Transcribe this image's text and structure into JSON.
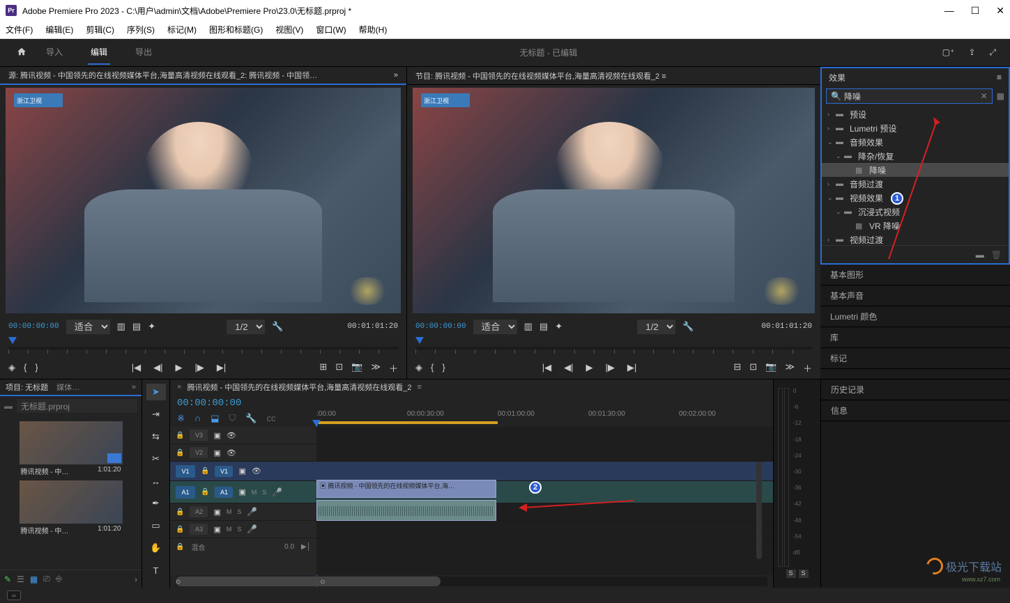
{
  "window": {
    "app_badge": "Pr",
    "title": "Adobe Premiere Pro 2023 - C:\\用户\\admin\\文档\\Adobe\\Premiere Pro\\23.0\\无标题.prproj *"
  },
  "menu": [
    "文件(F)",
    "编辑(E)",
    "剪辑(C)",
    "序列(S)",
    "标记(M)",
    "图形和标题(G)",
    "视图(V)",
    "窗口(W)",
    "帮助(H)"
  ],
  "workspace": {
    "tabs": [
      "导入",
      "编辑",
      "导出"
    ],
    "active": 1,
    "center": "无标题 - 已编辑"
  },
  "source_monitor": {
    "title": "源: 腾讯视频 - 中国领先的在线视频媒体平台,海量高清视频在线观看_2: 腾讯视频 - 中国领…",
    "channel": "浙江卫视",
    "timecode_left": "00:00:00:00",
    "fit": "适合",
    "zoom": "1/2",
    "timecode_right": "00:01:01:20"
  },
  "program_monitor": {
    "title": "节目: 腾讯视频 - 中国领先的在线视频媒体平台,海量高清视频在线观看_2  ≡",
    "channel": "浙江卫视",
    "timecode_left": "00:00:00:00",
    "fit": "适合",
    "zoom": "1/2",
    "timecode_right": "00:01:01:20"
  },
  "effects": {
    "title": "效果",
    "search_value": "降噪",
    "tree": [
      {
        "label": "预设",
        "depth": 0,
        "arrow": "›",
        "icon": "bin"
      },
      {
        "label": "Lumetri 预设",
        "depth": 0,
        "arrow": "›",
        "icon": "bin"
      },
      {
        "label": "音频效果",
        "depth": 0,
        "arrow": "⌄",
        "icon": "bin"
      },
      {
        "label": "降杂/恢复",
        "depth": 1,
        "arrow": "⌄",
        "icon": "bin"
      },
      {
        "label": "降噪",
        "depth": 2,
        "arrow": "",
        "icon": "fx",
        "selected": true
      },
      {
        "label": "音频过渡",
        "depth": 0,
        "arrow": "›",
        "icon": "bin"
      },
      {
        "label": "视频效果",
        "depth": 0,
        "arrow": "⌄",
        "icon": "bin",
        "badge": 1
      },
      {
        "label": "沉浸式视频",
        "depth": 1,
        "arrow": "⌄",
        "icon": "bin"
      },
      {
        "label": "VR 降噪",
        "depth": 2,
        "arrow": "",
        "icon": "fx"
      },
      {
        "label": "视频过渡",
        "depth": 0,
        "arrow": "›",
        "icon": "bin"
      }
    ]
  },
  "right_tabs": [
    "基本图形",
    "基本声音",
    "Lumetri 颜色",
    "库",
    "标记",
    "历史记录",
    "信息"
  ],
  "project": {
    "tab_active": "项目: 无标题",
    "tab_other": "媒体…",
    "search_placeholder": "无标题.prproj",
    "items": [
      {
        "name": "腾讯视频 - 中…",
        "duration": "1:01:20",
        "seq": true
      },
      {
        "name": "腾讯视频 - 中…",
        "duration": "1:01:20",
        "seq": false
      }
    ]
  },
  "timeline": {
    "sequence_name": "腾讯视频 - 中国领先的在线视频媒体平台,海量高清视频在线观看_2",
    "timecode": "00:00:00:00",
    "ruler": [
      ":00:00",
      "00:00:30:00",
      "00:01:00:00",
      "00:01:30:00",
      "00:02:00:00"
    ],
    "tracks_video": [
      "V3",
      "V2",
      "V1"
    ],
    "tracks_audio": [
      "A1",
      "A2",
      "A3"
    ],
    "clip_video_label": "腾讯视频 - 中国领先的在线视频媒体平台,海…",
    "mix_label": "混合",
    "mix_value": "0.0",
    "badge2": 2
  },
  "meters": {
    "scale": [
      "0",
      "-6",
      "-12",
      "-18",
      "-24",
      "-30",
      "-36",
      "-42",
      "-48",
      "-54",
      "dB"
    ],
    "solo": [
      "S",
      "S"
    ]
  },
  "watermark": {
    "text": "极光下载站",
    "url": "www.xz7.com"
  }
}
